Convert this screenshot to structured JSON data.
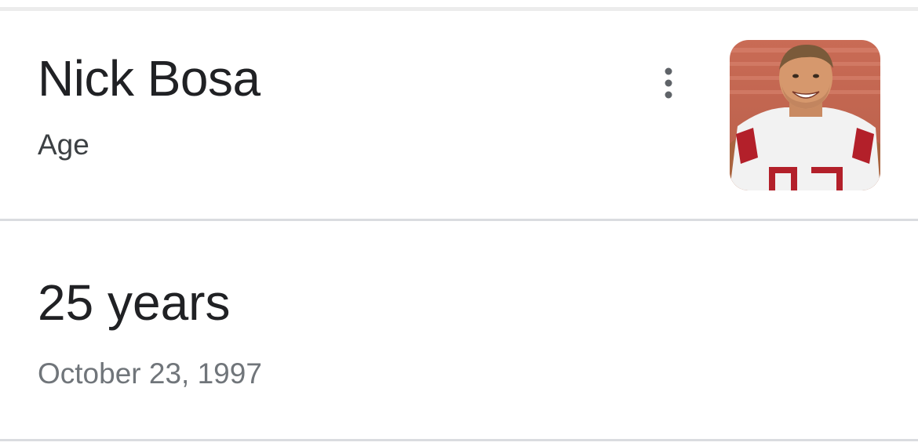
{
  "entity": {
    "name": "Nick Bosa",
    "attribute": "Age"
  },
  "answer": {
    "value": "25 years",
    "detail": "October 23, 1997"
  },
  "icons": {
    "more": "more-vert-icon",
    "photo": "player-photo"
  },
  "colors": {
    "title": "#202124",
    "subtitle": "#3c4043",
    "secondary": "#70757a",
    "divider": "#dadce0",
    "jersey_red": "#b3202a"
  }
}
